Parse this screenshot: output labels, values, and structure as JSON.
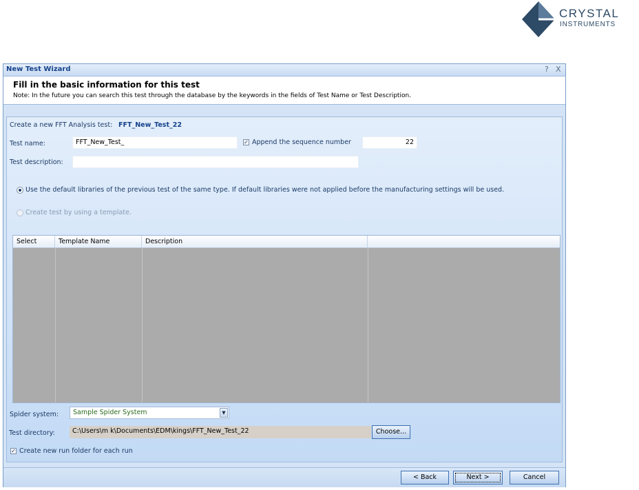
{
  "logo": {
    "line1": "CRYSTAL",
    "line2": "INSTRUMENTS"
  },
  "window": {
    "title": "New Test Wizard",
    "help_label": "?",
    "close_label": "X"
  },
  "header": {
    "heading": "Fill in the basic information for this test",
    "note": "Note: In the future you can search this test through the database by the keywords in the fields of Test Name or Test Description."
  },
  "form": {
    "create_label": "Create a new FFT Analysis test:",
    "create_value": "FFT_New_Test_22",
    "test_name_label": "Test name:",
    "test_name_value": "FFT_New_Test_",
    "append_label": "Append the sequence number",
    "append_checked": true,
    "sequence_value": "22",
    "test_desc_label": "Test description:",
    "test_desc_value": "",
    "option_default": "Use the default libraries of the previous test of the same type. If default libraries were not applied before the manufacturing settings will be used.",
    "option_template": "Create test by using a template."
  },
  "grid": {
    "columns": [
      "Select",
      "Template Name",
      "Description",
      ""
    ]
  },
  "bottom": {
    "spider_label": "Spider system:",
    "spider_value": "Sample Spider System",
    "dir_label": "Test directory:",
    "dir_value": "C:\\Users\\m k\\Documents\\EDM\\kings\\FFT_New_Test_22",
    "choose_label": "Choose...",
    "run_folder_label": "Create new run folder for each run",
    "run_folder_checked": true
  },
  "buttons": {
    "back": "< Back",
    "next": "Next >",
    "cancel": "Cancel"
  },
  "icons": {
    "checkmark": "✓",
    "dropdown": "▼"
  }
}
